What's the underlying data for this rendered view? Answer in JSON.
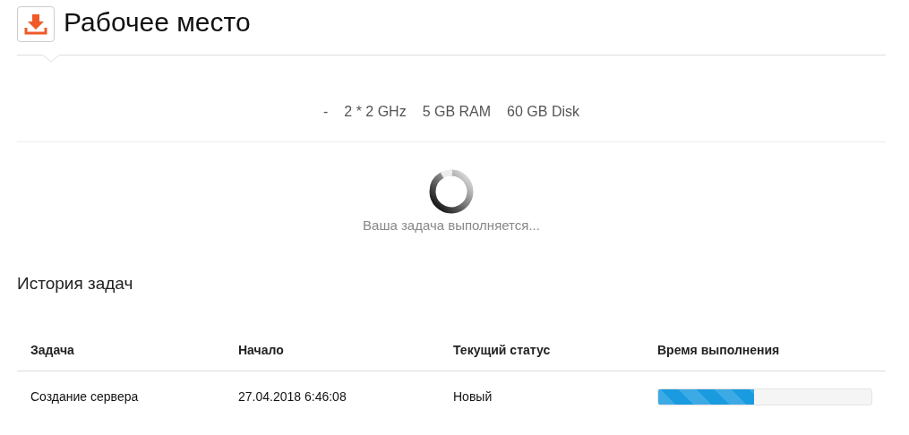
{
  "header": {
    "title": "Рабочее место"
  },
  "specs": [
    "-",
    "2 * 2 GHz",
    "5 GB RAM",
    "60 GB Disk"
  ],
  "status": {
    "message": "Ваша задача выполняется..."
  },
  "history": {
    "title": "История задач",
    "columns": [
      "Задача",
      "Начало",
      "Текущий статус",
      "Время выполнения"
    ],
    "rows": [
      {
        "task": "Создание сервера",
        "start": "27.04.2018 6:46:08",
        "status": "Новый",
        "level": 0.45
      }
    ]
  }
}
